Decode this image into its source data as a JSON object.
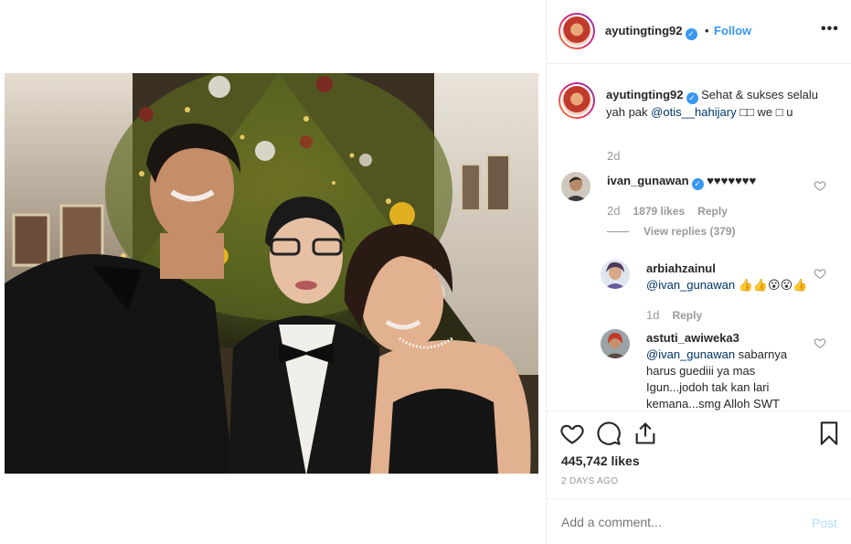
{
  "post": {
    "username": "ayutingting92",
    "verified_icon": "verified-icon",
    "separator": "•",
    "follow_label": "Follow",
    "more_label": "•••"
  },
  "caption": {
    "username": "ayutingting92",
    "text_before": " Sehat & sukses selalu yah pak ",
    "mention": "@otis__hahijary",
    "text_after": " □□ we □ u",
    "time": "2d"
  },
  "comments": [
    {
      "username": "ivan_gunawan",
      "text": " ♥♥♥♥♥♥♥",
      "time": "2d",
      "likes": "1879 likes",
      "reply_label": "Reply",
      "view_replies": "View replies (379)"
    },
    {
      "username": "arbiahzainul",
      "mention": "@ivan_gunawan",
      "text": " 👍👍😮😮👍",
      "time": "1d",
      "reply_label": "Reply"
    },
    {
      "username": "astuti_awiweka3",
      "mention": "@ivan_gunawan",
      "text": " sabarnya harus guediii ya mas Igun...jodoh tak kan lari kemana...smg Alloh SWT"
    }
  ],
  "actions": {
    "like_icon": "heart-icon",
    "comment_icon": "comment-icon",
    "share_icon": "share-icon",
    "save_icon": "bookmark-icon",
    "likes": "445,742 likes",
    "date": "2 DAYS AGO"
  },
  "add_comment": {
    "placeholder": "Add a comment...",
    "post_label": "Post"
  },
  "colors": {
    "link": "#3897f0",
    "mention": "#003569",
    "muted": "#999999",
    "post_disabled": "#b2dffc"
  }
}
